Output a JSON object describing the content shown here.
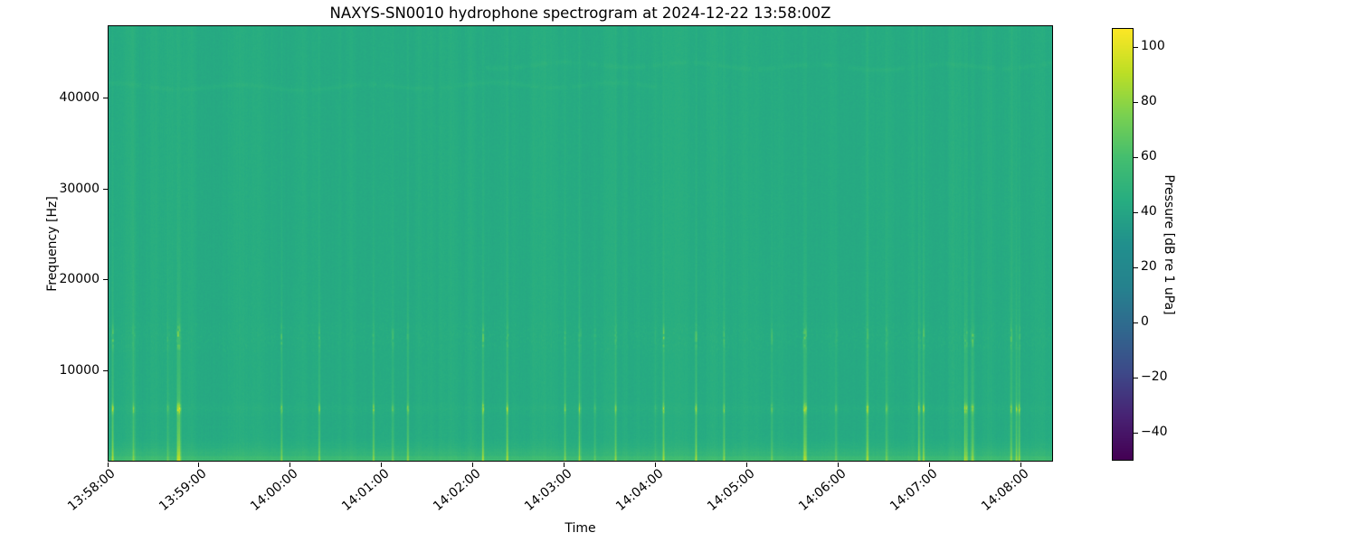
{
  "chart_data": {
    "type": "heatmap",
    "subtype": "spectrogram",
    "title": "NAXYS-SN0010 hydrophone spectrogram at 2024-12-22 13:58:00Z",
    "xlabel": "Time",
    "ylabel": "Frequency [Hz]",
    "x_ticks": [
      {
        "seconds": 0,
        "label": "13:58:00"
      },
      {
        "seconds": 60,
        "label": "13:59:00"
      },
      {
        "seconds": 120,
        "label": "14:00:00"
      },
      {
        "seconds": 180,
        "label": "14:01:00"
      },
      {
        "seconds": 240,
        "label": "14:02:00"
      },
      {
        "seconds": 300,
        "label": "14:03:00"
      },
      {
        "seconds": 360,
        "label": "14:04:00"
      },
      {
        "seconds": 420,
        "label": "14:05:00"
      },
      {
        "seconds": 480,
        "label": "14:06:00"
      },
      {
        "seconds": 540,
        "label": "14:07:00"
      },
      {
        "seconds": 600,
        "label": "14:08:00"
      }
    ],
    "x_range_seconds": [
      0,
      621
    ],
    "y_ticks": [
      {
        "hz": 10000,
        "label": "10000"
      },
      {
        "hz": 20000,
        "label": "20000"
      },
      {
        "hz": 30000,
        "label": "30000"
      },
      {
        "hz": 40000,
        "label": "40000"
      }
    ],
    "y_range_hz": [
      0,
      48000
    ],
    "grid": false,
    "colorbar": {
      "label": "Pressure [dB re 1 uPa]",
      "colormap": "viridis",
      "vmin": -50,
      "vmax": 107,
      "ticks": [
        {
          "value": 100,
          "label": "100"
        },
        {
          "value": 80,
          "label": "80"
        },
        {
          "value": 60,
          "label": "60"
        },
        {
          "value": 40,
          "label": "40"
        },
        {
          "value": 20,
          "label": "20"
        },
        {
          "value": 0,
          "label": "0"
        },
        {
          "value": -20,
          "label": "−20"
        },
        {
          "value": -40,
          "label": "−40"
        }
      ]
    },
    "content": {
      "noise_floor_db": 42.5,
      "low_freq_band": {
        "cutoff_hz": 1150,
        "boost_db": 15
      },
      "click_band_1": {
        "center_hz": 5800,
        "half_width_hz": 520
      },
      "click_band_2": {
        "center_hz": 13700,
        "half_width_hz": 1250
      },
      "tonal_lines": [
        {
          "freq_hz": 41400,
          "x_start_frac": 0.0,
          "x_end_frac": 0.58,
          "boost_db": 2.4
        },
        {
          "freq_hz": 43650,
          "x_start_frac": 0.4,
          "x_end_frac": 1.0,
          "boost_db": 2.8
        }
      ],
      "strong_transients_frac": [
        0.004,
        0.073,
        0.183,
        0.317,
        0.422,
        0.537,
        0.623,
        0.652,
        0.738,
        0.805,
        0.91,
        0.963
      ],
      "seed": 12022
    }
  }
}
